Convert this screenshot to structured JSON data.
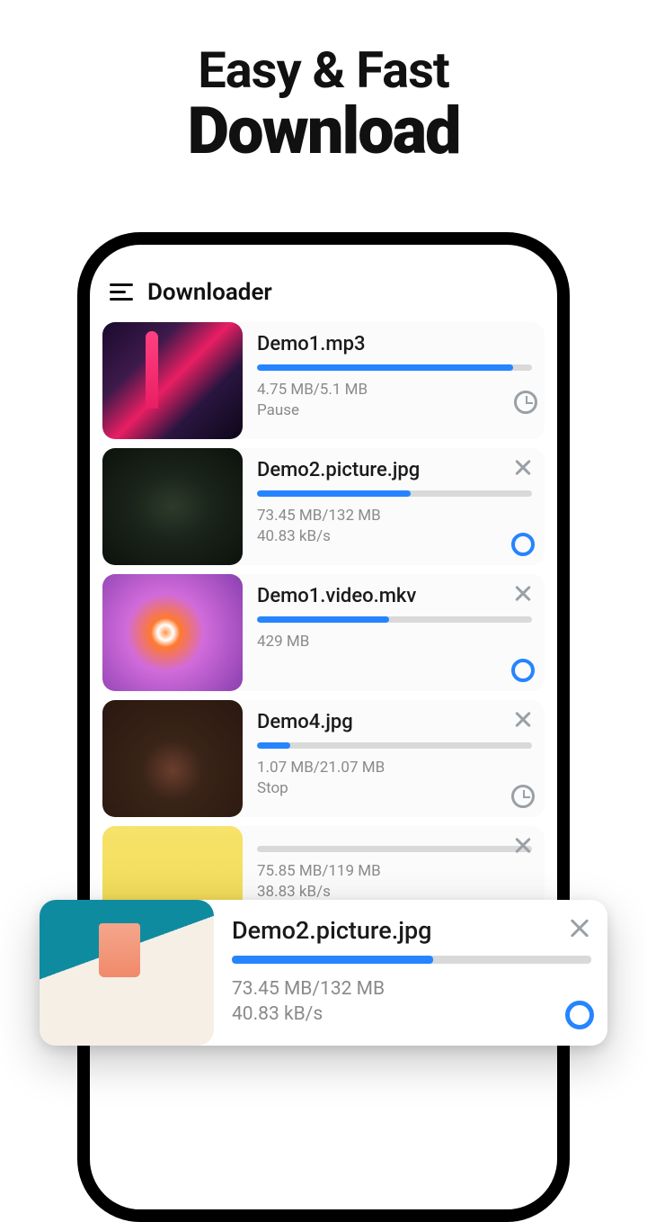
{
  "hero": {
    "line1": "Easy & Fast",
    "line2": "Download"
  },
  "app": {
    "title": "Downloader"
  },
  "downloads": [
    {
      "name": "Demo1.mp3",
      "progress_pct": 93,
      "size_line": "4.75 MB/5.1 MB",
      "status_line": "Pause",
      "action_top": "none",
      "action_bottom": "clock",
      "thumb": "city"
    },
    {
      "name": "Demo2.picture.jpg",
      "progress_pct": 56,
      "size_line": "73.45 MB/132 MB",
      "status_line": "40.83 kB/s",
      "action_top": "close",
      "action_bottom": "ring",
      "thumb": "plant"
    },
    {
      "name": "Demo1.video.mkv",
      "progress_pct": 48,
      "size_line": "429 MB",
      "status_line": "",
      "action_top": "close",
      "action_bottom": "ring",
      "thumb": "fish"
    },
    {
      "name": "Demo4.jpg",
      "progress_pct": 12,
      "size_line": "1.07 MB/21.07 MB",
      "status_line": "Stop",
      "action_top": "close",
      "action_bottom": "clock",
      "thumb": "food"
    },
    {
      "name": "",
      "progress_pct": 0,
      "size_line": "75.85 MB/119 MB",
      "status_line": "38.83 kB/s",
      "action_top": "close",
      "action_bottom": "ring",
      "thumb": "bottle"
    }
  ],
  "float": {
    "name": "Demo2.picture.jpg",
    "progress_pct": 56,
    "size_line": "73.45 MB/132 MB",
    "status_line": "40.83 kB/s",
    "thumb": "drink"
  },
  "colors": {
    "accent": "#2684ff",
    "muted": "#8a8a8a"
  }
}
